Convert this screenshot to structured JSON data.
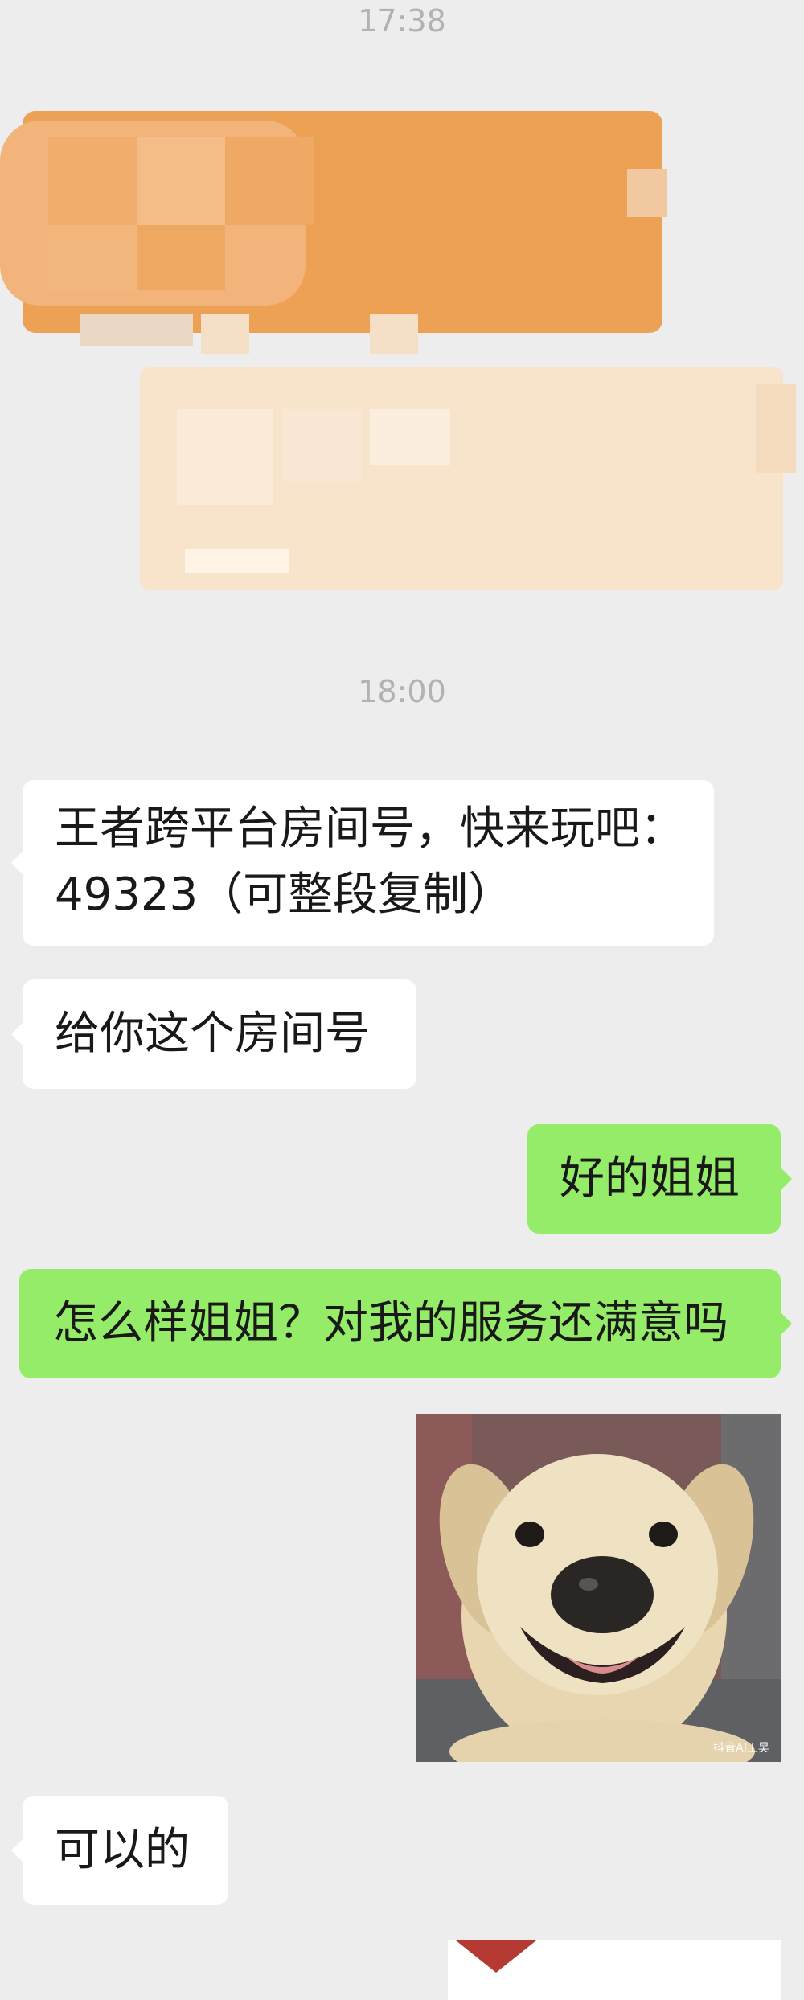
{
  "timestamps": [
    "17:38",
    "18:00"
  ],
  "messages": {
    "room_invite_line1": "王者跨平台房间号，快来玩吧：",
    "room_invite_line2": "49323（可整段复制）",
    "give_room": "给你这个房间号",
    "ok_sister": "好的姐姐",
    "how_was_service": "怎么样姐姐？对我的服务还满意吗",
    "that_works": "可以的"
  },
  "sticker": {
    "icon": "smiling-dog-sticker",
    "watermark": "抖音AI王昊"
  },
  "colors": {
    "background": "#EDEDED",
    "incoming_bubble": "#FFFFFF",
    "outgoing_bubble": "#95EC69",
    "timestamp": "#B2B2B2",
    "censor_orange": "#EDA155",
    "censor_cream": "#F7E4CB"
  }
}
